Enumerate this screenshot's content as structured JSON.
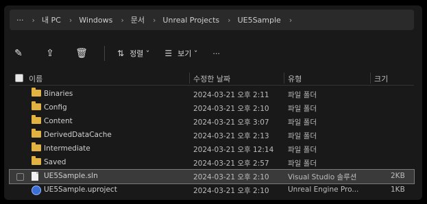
{
  "breadcrumb": [
    "내 PC",
    "Windows",
    "문서",
    "Unreal Projects",
    "UE5Sample"
  ],
  "toolbar": {
    "sort_label": "정렬",
    "view_label": "보기",
    "more_label": "···"
  },
  "columns": {
    "name": "이름",
    "date": "수정한 날짜",
    "type": "유형",
    "size": "크기"
  },
  "rows": [
    {
      "icon": "folder",
      "name": "Binaries",
      "date": "2024-03-21 오후 2:11",
      "type": "파일 폴더",
      "size": ""
    },
    {
      "icon": "folder",
      "name": "Config",
      "date": "2024-03-21 오후 2:10",
      "type": "파일 폴더",
      "size": ""
    },
    {
      "icon": "folder",
      "name": "Content",
      "date": "2024-03-21 오후 3:07",
      "type": "파일 폴더",
      "size": ""
    },
    {
      "icon": "folder",
      "name": "DerivedDataCache",
      "date": "2024-03-21 오후 2:13",
      "type": "파일 폴더",
      "size": ""
    },
    {
      "icon": "folder",
      "name": "Intermediate",
      "date": "2024-03-21 오후 12:14",
      "type": "파일 폴더",
      "size": ""
    },
    {
      "icon": "folder",
      "name": "Saved",
      "date": "2024-03-21 오후 2:57",
      "type": "파일 폴더",
      "size": ""
    },
    {
      "icon": "file",
      "name": "UE5Sample.sln",
      "date": "2024-03-21 오후 2:10",
      "type": "Visual Studio 솔루션",
      "size": "2KB",
      "selected": true
    },
    {
      "icon": "ue",
      "name": "UE5Sample.uproject",
      "date": "2024-03-21 오후 2:10",
      "type": "Unreal Engine Pro...",
      "size": "1KB"
    }
  ]
}
